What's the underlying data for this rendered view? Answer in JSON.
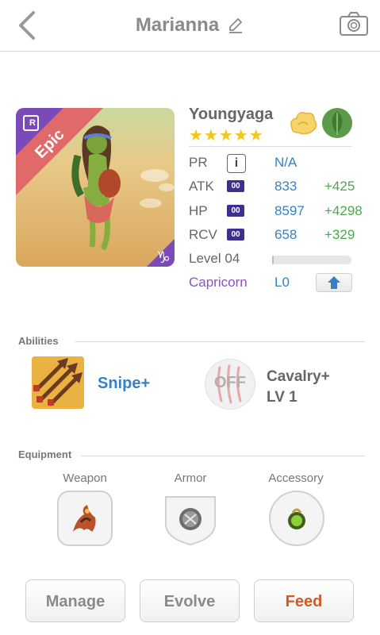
{
  "header": {
    "title": "Marianna"
  },
  "monster": {
    "name": "Youngyaga",
    "rarity": "Epic",
    "rarity_badge": "R",
    "stars": 5,
    "stars_text": "★★★★★",
    "sign_glyph": "♑"
  },
  "stats": {
    "pr": {
      "label": "PR",
      "info": "i",
      "value": "N/A"
    },
    "atk": {
      "label": "ATK",
      "badge": "00",
      "value": "833",
      "bonus": "+425"
    },
    "hp": {
      "label": "HP",
      "badge": "00",
      "value": "8597",
      "bonus": "+4298"
    },
    "rcv": {
      "label": "RCV",
      "badge": "00",
      "value": "658",
      "bonus": "+329"
    },
    "level": {
      "label": "Level 04",
      "progress": 0.02
    },
    "zodiac": {
      "label": "Capricorn",
      "value": "L0"
    }
  },
  "abilities": {
    "section": "Abilities",
    "ability1": {
      "label": "Snipe+"
    },
    "ability2": {
      "state": "OFF",
      "name": "Cavalry+",
      "level": "LV 1"
    }
  },
  "equipment": {
    "section": "Equipment",
    "slots": [
      {
        "label": "Weapon"
      },
      {
        "label": "Armor"
      },
      {
        "label": "Accessory"
      }
    ]
  },
  "actions": {
    "manage": "Manage",
    "evolve": "Evolve",
    "feed": "Feed"
  },
  "colors": {
    "stat_value": "#3a7fc1",
    "bonus": "#4aa84a",
    "zodiac": "#8a55b8",
    "feed": "#d35a22",
    "badge": "#3c2f8e"
  }
}
